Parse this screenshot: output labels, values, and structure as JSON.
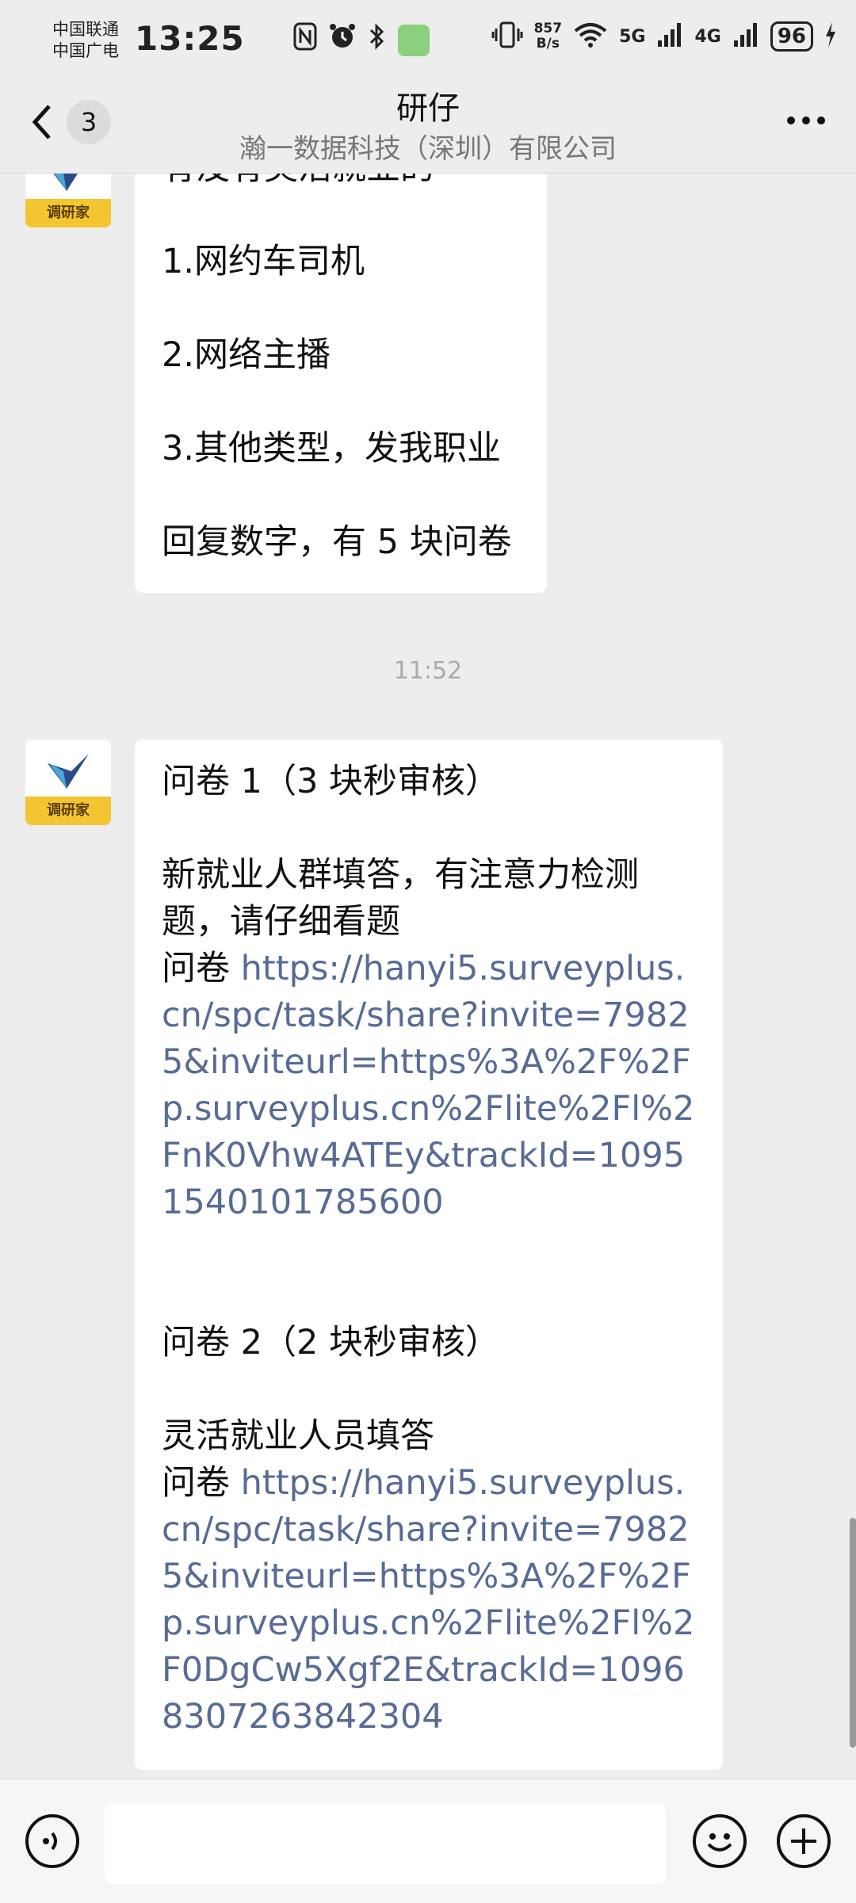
{
  "status_bar": {
    "carrier_1": "中国联通",
    "carrier_2": "中国广电",
    "time": "13:25",
    "speed_value": "857",
    "speed_unit": "B/s",
    "net_1": "5G",
    "net_2": "4G",
    "battery": "96",
    "icons": [
      "nfc-icon",
      "alarm-icon",
      "bluetooth-icon",
      "app-notification-icon",
      "vibrate-icon",
      "wifi-icon",
      "signal-icon",
      "charging-icon"
    ]
  },
  "header": {
    "back_count": "3",
    "title": "研仔",
    "subtitle": "瀚一数据科技（深圳）有限公司"
  },
  "messages": {
    "first": {
      "partial_line": "有没有灵活就业的",
      "line1": "1.网约车司机",
      "line2": "2.网络主播",
      "line3": "3.其他类型，发我职业",
      "line4": "回复数字，有 5 块问卷"
    },
    "timestamp": "11:52",
    "second": {
      "q1_title": "问卷 1（3 块秒审核）",
      "q1_desc": "新就业人群填答，有注意力检测题，请仔细看题",
      "q1_prefix": "问卷 ",
      "q1_link": "https://hanyi5.surveyplus.cn/spc/task/share?invite=79825&inviteurl=https%3A%2F%2Fp.surveyplus.cn%2Flite%2Fl%2FnK0Vhw4ATEy&trackId=10951540101785600",
      "q2_title": "问卷 2（2 块秒审核）",
      "q2_desc": "灵活就业人员填答",
      "q2_prefix": "问卷 ",
      "q2_link": "https://hanyi5.surveyplus.cn/spc/task/share?invite=79825&inviteurl=https%3A%2F%2Fp.surveyplus.cn%2Flite%2Fl%2F0DgCw5Xgf2E&trackId=10968307263842304"
    },
    "avatar_label": "调研家"
  },
  "input_bar": {
    "input_value": ""
  },
  "colors": {
    "background": "#ededed",
    "bubble": "#ffffff",
    "link": "#576b95",
    "avatar_band": "#f3c531"
  }
}
